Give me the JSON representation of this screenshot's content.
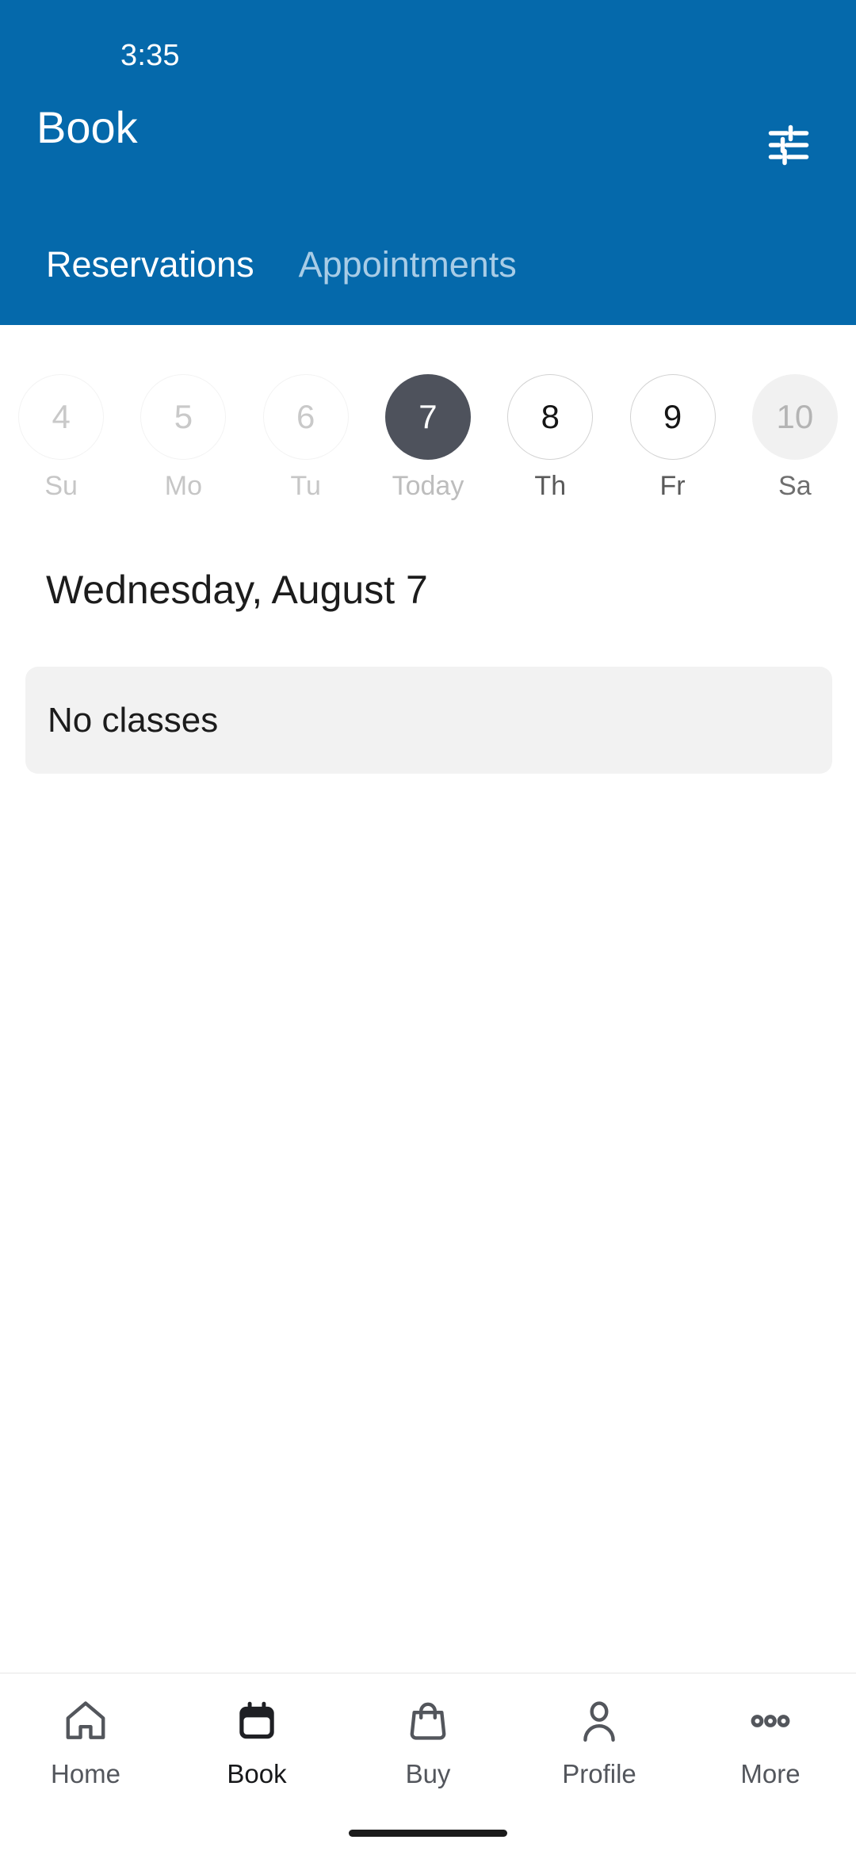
{
  "theme": {
    "header_blue": "#0569ab",
    "selected_date_bg": "#4e525c",
    "card_bg": "#f2f2f2",
    "inactive_tab": "#a8cce6"
  },
  "status_bar": {
    "time": "3:35"
  },
  "header": {
    "title": "Book",
    "filter_icon": "tune-icon",
    "tabs": [
      {
        "label": "Reservations",
        "active": true
      },
      {
        "label": "Appointments",
        "active": false
      }
    ]
  },
  "date_strip": {
    "dates": [
      {
        "day_number": "4",
        "day_label": "Su",
        "state": "past"
      },
      {
        "day_number": "5",
        "day_label": "Mo",
        "state": "past"
      },
      {
        "day_number": "6",
        "day_label": "Tu",
        "state": "past"
      },
      {
        "day_number": "7",
        "day_label": "Today",
        "state": "selected"
      },
      {
        "day_number": "8",
        "day_label": "Th",
        "state": "future"
      },
      {
        "day_number": "9",
        "day_label": "Fr",
        "state": "future"
      },
      {
        "day_number": "10",
        "day_label": "Sa",
        "state": "edge"
      }
    ]
  },
  "content": {
    "day_heading": "Wednesday, August 7",
    "empty_state": "No classes"
  },
  "bottom_nav": {
    "items": [
      {
        "label": "Home",
        "icon": "home-icon",
        "active": false
      },
      {
        "label": "Book",
        "icon": "calendar-icon",
        "active": true
      },
      {
        "label": "Buy",
        "icon": "shopping-bag-icon",
        "active": false
      },
      {
        "label": "Profile",
        "icon": "person-icon",
        "active": false
      },
      {
        "label": "More",
        "icon": "more-dots-icon",
        "active": false
      }
    ]
  }
}
